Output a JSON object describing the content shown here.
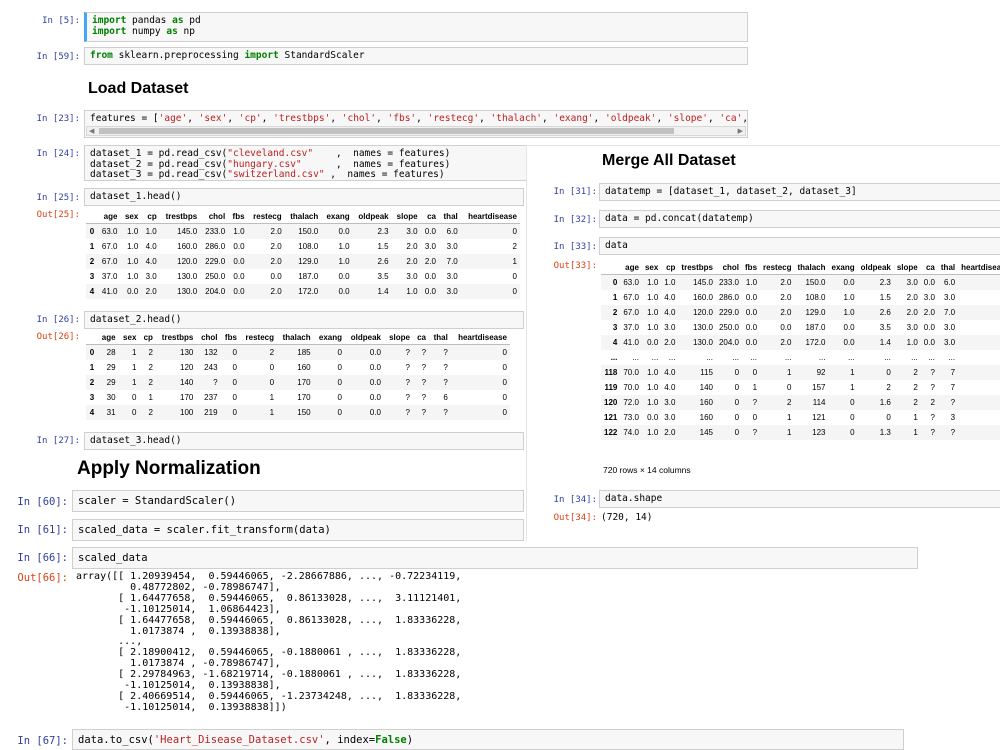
{
  "panel_a": {
    "cells": [
      {
        "prompt": "In [5]:",
        "lines": [
          [
            {
              "t": "import",
              "c": "kw"
            },
            {
              "t": " pandas "
            },
            {
              "t": "as",
              "c": "kw"
            },
            {
              "t": " pd"
            }
          ],
          [
            {
              "t": "import",
              "c": "kw"
            },
            {
              "t": " numpy "
            },
            {
              "t": "as",
              "c": "kw"
            },
            {
              "t": " np"
            }
          ]
        ]
      },
      {
        "prompt": "In [59]:",
        "lines": [
          [
            {
              "t": "from",
              "c": "kw"
            },
            {
              "t": " sklearn.preprocessing "
            },
            {
              "t": "import",
              "c": "kw"
            },
            {
              "t": " StandardScaler"
            }
          ]
        ]
      },
      {
        "prompt": "In [23]:",
        "lines": [
          [
            {
              "t": "features = ["
            },
            {
              "t": "'age'",
              "c": "str"
            },
            {
              "t": ", "
            },
            {
              "t": "'sex'",
              "c": "str"
            },
            {
              "t": ", "
            },
            {
              "t": "'cp'",
              "c": "str"
            },
            {
              "t": ", "
            },
            {
              "t": "'trestbps'",
              "c": "str"
            },
            {
              "t": ", "
            },
            {
              "t": "'chol'",
              "c": "str"
            },
            {
              "t": ", "
            },
            {
              "t": "'fbs'",
              "c": "str"
            },
            {
              "t": ", "
            },
            {
              "t": "'restecg'",
              "c": "str"
            },
            {
              "t": ", "
            },
            {
              "t": "'thalach'",
              "c": "str"
            },
            {
              "t": ", "
            },
            {
              "t": "'exang'",
              "c": "str"
            },
            {
              "t": ", "
            },
            {
              "t": "'oldpeak'",
              "c": "str"
            },
            {
              "t": ", "
            },
            {
              "t": "'slope'",
              "c": "str"
            },
            {
              "t": ", "
            },
            {
              "t": "'ca'",
              "c": "str"
            },
            {
              "t": ", "
            },
            {
              "t": "'thal'",
              "c": "str"
            },
            {
              "t": ", "
            },
            {
              "t": "'hear",
              "c": "str"
            }
          ]
        ]
      },
      {
        "prompt": "In [24]:",
        "lines": [
          [
            {
              "t": "dataset_1 = pd.read_csv("
            },
            {
              "t": "\"cleveland.csv\"",
              "c": "str"
            },
            {
              "t": "    ,  names = features)"
            }
          ],
          [
            {
              "t": "dataset_2 = pd.read_csv("
            },
            {
              "t": "\"hungary.csv\"",
              "c": "str"
            },
            {
              "t": "      ,  names = features)"
            }
          ],
          [
            {
              "t": "dataset_3 = pd.read_csv("
            },
            {
              "t": "\"switzerland.csv\"",
              "c": "str"
            },
            {
              "t": " ,  names = features)"
            }
          ]
        ]
      },
      {
        "prompt": "In [25]:",
        "lines": [
          [
            {
              "t": "dataset_1.head()"
            }
          ]
        ]
      },
      {
        "prompt": "In [26]:",
        "lines": [
          [
            {
              "t": "dataset_2.head()"
            }
          ]
        ]
      },
      {
        "prompt": "In [27]:",
        "lines": [
          [
            {
              "t": "dataset_3.head()"
            }
          ]
        ]
      }
    ],
    "out25_prompt": "Out[25]:",
    "out26_prompt": "Out[26]:",
    "heading_load": "Load Dataset"
  },
  "columns": [
    "age",
    "sex",
    "cp",
    "trestbps",
    "chol",
    "fbs",
    "restecg",
    "thalach",
    "exang",
    "oldpeak",
    "slope",
    "ca",
    "thal",
    "heartdisease"
  ],
  "table25": {
    "rows": [
      [
        "0",
        "63.0",
        "1.0",
        "1.0",
        "145.0",
        "233.0",
        "1.0",
        "2.0",
        "150.0",
        "0.0",
        "2.3",
        "3.0",
        "0.0",
        "6.0",
        "0"
      ],
      [
        "1",
        "67.0",
        "1.0",
        "4.0",
        "160.0",
        "286.0",
        "0.0",
        "2.0",
        "108.0",
        "1.0",
        "1.5",
        "2.0",
        "3.0",
        "3.0",
        "2"
      ],
      [
        "2",
        "67.0",
        "1.0",
        "4.0",
        "120.0",
        "229.0",
        "0.0",
        "2.0",
        "129.0",
        "1.0",
        "2.6",
        "2.0",
        "2.0",
        "7.0",
        "1"
      ],
      [
        "3",
        "37.0",
        "1.0",
        "3.0",
        "130.0",
        "250.0",
        "0.0",
        "0.0",
        "187.0",
        "0.0",
        "3.5",
        "3.0",
        "0.0",
        "3.0",
        "0"
      ],
      [
        "4",
        "41.0",
        "0.0",
        "2.0",
        "130.0",
        "204.0",
        "0.0",
        "2.0",
        "172.0",
        "0.0",
        "1.4",
        "1.0",
        "0.0",
        "3.0",
        "0"
      ]
    ]
  },
  "table26": {
    "rows": [
      [
        "0",
        "28",
        "1",
        "2",
        "130",
        "132",
        "0",
        "2",
        "185",
        "0",
        "0.0",
        "?",
        "?",
        "?",
        "0"
      ],
      [
        "1",
        "29",
        "1",
        "2",
        "120",
        "243",
        "0",
        "0",
        "160",
        "0",
        "0.0",
        "?",
        "?",
        "?",
        "0"
      ],
      [
        "2",
        "29",
        "1",
        "2",
        "140",
        "?",
        "0",
        "0",
        "170",
        "0",
        "0.0",
        "?",
        "?",
        "?",
        "0"
      ],
      [
        "3",
        "30",
        "0",
        "1",
        "170",
        "237",
        "0",
        "1",
        "170",
        "0",
        "0.0",
        "?",
        "?",
        "6",
        "0"
      ],
      [
        "4",
        "31",
        "0",
        "2",
        "100",
        "219",
        "0",
        "1",
        "150",
        "0",
        "0.0",
        "?",
        "?",
        "?",
        "0"
      ]
    ]
  },
  "panel_b": {
    "heading": "Merge All Dataset",
    "cells": [
      {
        "prompt": "In [31]:",
        "lines": [
          [
            {
              "t": "datatemp = [dataset_1, dataset_2, dataset_3]"
            }
          ]
        ]
      },
      {
        "prompt": "In [32]:",
        "lines": [
          [
            {
              "t": "data = pd.concat(datatemp)"
            }
          ]
        ]
      },
      {
        "prompt": "In [33]:",
        "lines": [
          [
            {
              "t": "data"
            }
          ]
        ]
      },
      {
        "prompt": "In [34]:",
        "lines": [
          [
            {
              "t": "data.shape"
            }
          ]
        ]
      }
    ],
    "out33_prompt": "Out[33]:",
    "out34_prompt": "Out[34]:",
    "shape_value": "(720, 14)",
    "rows_cols": "720 rows × 14 columns",
    "table33_rows": [
      [
        "0",
        "63.0",
        "1.0",
        "1.0",
        "145.0",
        "233.0",
        "1.0",
        "2.0",
        "150.0",
        "0.0",
        "2.3",
        "3.0",
        "0.0",
        "6.0",
        "0"
      ],
      [
        "1",
        "67.0",
        "1.0",
        "4.0",
        "160.0",
        "286.0",
        "0.0",
        "2.0",
        "108.0",
        "1.0",
        "1.5",
        "2.0",
        "3.0",
        "3.0",
        "2"
      ],
      [
        "2",
        "67.0",
        "1.0",
        "4.0",
        "120.0",
        "229.0",
        "0.0",
        "2.0",
        "129.0",
        "1.0",
        "2.6",
        "2.0",
        "2.0",
        "7.0",
        "1"
      ],
      [
        "3",
        "37.0",
        "1.0",
        "3.0",
        "130.0",
        "250.0",
        "0.0",
        "0.0",
        "187.0",
        "0.0",
        "3.5",
        "3.0",
        "0.0",
        "3.0",
        "0"
      ],
      [
        "4",
        "41.0",
        "0.0",
        "2.0",
        "130.0",
        "204.0",
        "0.0",
        "2.0",
        "172.0",
        "0.0",
        "1.4",
        "1.0",
        "0.0",
        "3.0",
        "0"
      ],
      [
        "...",
        "...",
        "...",
        "...",
        "...",
        "...",
        "...",
        "...",
        "...",
        "...",
        "...",
        "...",
        "...",
        "...",
        "..."
      ],
      [
        "118",
        "70.0",
        "1.0",
        "4.0",
        "115",
        "0",
        "0",
        "1",
        "92",
        "1",
        "0",
        "2",
        "?",
        "7",
        "1"
      ],
      [
        "119",
        "70.0",
        "1.0",
        "4.0",
        "140",
        "0",
        "1",
        "0",
        "157",
        "1",
        "2",
        "2",
        "?",
        "7",
        "3"
      ],
      [
        "120",
        "72.0",
        "1.0",
        "3.0",
        "160",
        "0",
        "?",
        "2",
        "114",
        "0",
        "1.6",
        "2",
        "2",
        "?",
        "0"
      ],
      [
        "121",
        "73.0",
        "0.0",
        "3.0",
        "160",
        "0",
        "0",
        "1",
        "121",
        "0",
        "0",
        "1",
        "?",
        "3",
        "1"
      ],
      [
        "122",
        "74.0",
        "1.0",
        "2.0",
        "145",
        "0",
        "?",
        "1",
        "123",
        "0",
        "1.3",
        "1",
        "?",
        "?",
        "1"
      ]
    ]
  },
  "panel_c": {
    "heading": "Apply Normalization",
    "cells": [
      {
        "prompt": "In [60]:",
        "lines": [
          [
            {
              "t": "scaler = StandardScaler()"
            }
          ]
        ]
      },
      {
        "prompt": "In [61]:",
        "lines": [
          [
            {
              "t": "scaled_data = scaler.fit_transform(data)"
            }
          ]
        ]
      }
    ]
  },
  "panel_d": {
    "cells": [
      {
        "prompt": "In [66]:",
        "lines": [
          [
            {
              "t": "scaled_data"
            }
          ]
        ]
      },
      {
        "prompt": "In [67]:",
        "lines": [
          [
            {
              "t": "data.to_csv("
            },
            {
              "t": "'Heart_Disease_Dataset.csv'",
              "c": "str"
            },
            {
              "t": ", index="
            },
            {
              "t": "False",
              "c": "kw"
            },
            {
              "t": ")"
            }
          ]
        ]
      }
    ],
    "out66_prompt": "Out[66]:",
    "array_text": "array([[ 1.20939454,  0.59446065, -2.28667886, ..., -0.72234119,\n         0.48772802, -0.78986747],\n       [ 1.64477658,  0.59446065,  0.86133028, ...,  3.11121401,\n        -1.10125014,  1.06864423],\n       [ 1.64477658,  0.59446065,  0.86133028, ...,  1.83336228,\n         1.0173874 ,  0.13938838],\n       ...,\n       [ 2.18900412,  0.59446065, -0.1880061 , ...,  1.83336228,\n         1.0173874 , -0.78986747],\n       [ 2.29784963, -1.68219714, -0.1880061 , ...,  1.83336228,\n        -1.10125014,  0.13938838],\n       [ 2.40669514,  0.59446065, -1.23734248, ...,  1.83336228,\n        -1.10125014,  0.13938838]])"
  }
}
